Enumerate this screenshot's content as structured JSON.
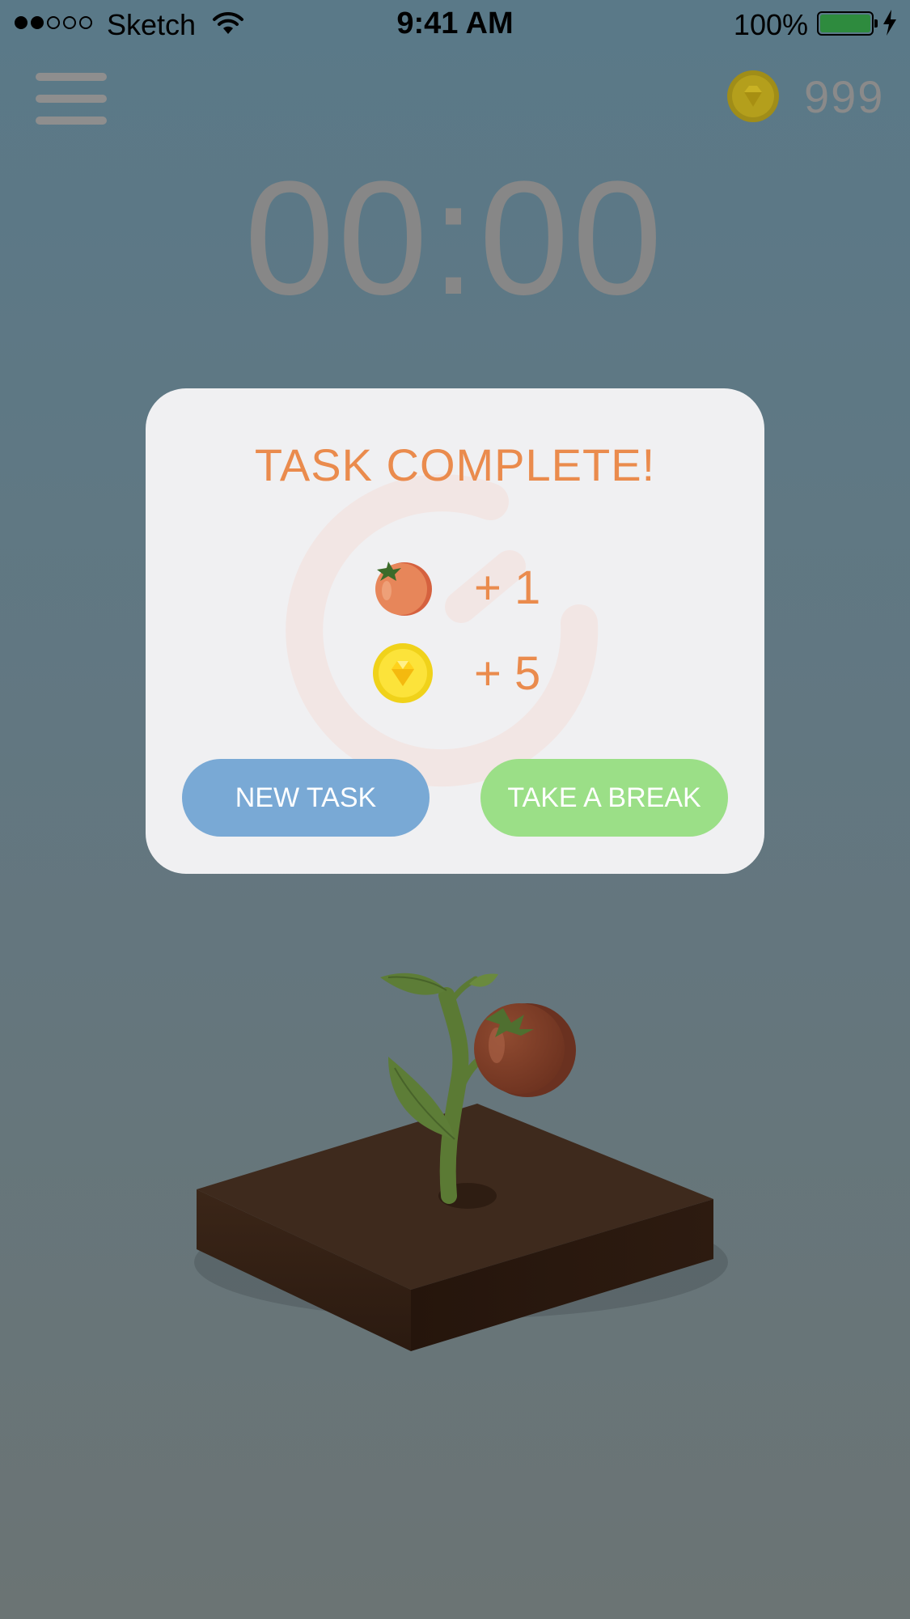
{
  "status_bar": {
    "carrier": "Sketch",
    "time": "9:41 AM",
    "battery": "100%",
    "signal_filled": 2,
    "signal_total": 5
  },
  "header": {
    "menu_icon": "hamburger-menu-icon",
    "coin_icon": "gold-coin-icon",
    "coin_count": "999"
  },
  "timer": {
    "display": "00:00"
  },
  "modal": {
    "title": "TASK COMPLETE!",
    "rewards": [
      {
        "icon": "tomato-icon",
        "amount": "+ 1"
      },
      {
        "icon": "gold-coin-icon",
        "amount": "+ 5"
      }
    ],
    "buttons": {
      "new_task": "NEW TASK",
      "take_break": "TAKE A BREAK"
    }
  },
  "plant": {
    "icon": "tomato-plant-illustration"
  },
  "colors": {
    "accent_orange": "#ea8b4d",
    "button_blue": "#79a9d5",
    "button_green": "#9bdf87",
    "battery_green": "#2e8b3e"
  }
}
